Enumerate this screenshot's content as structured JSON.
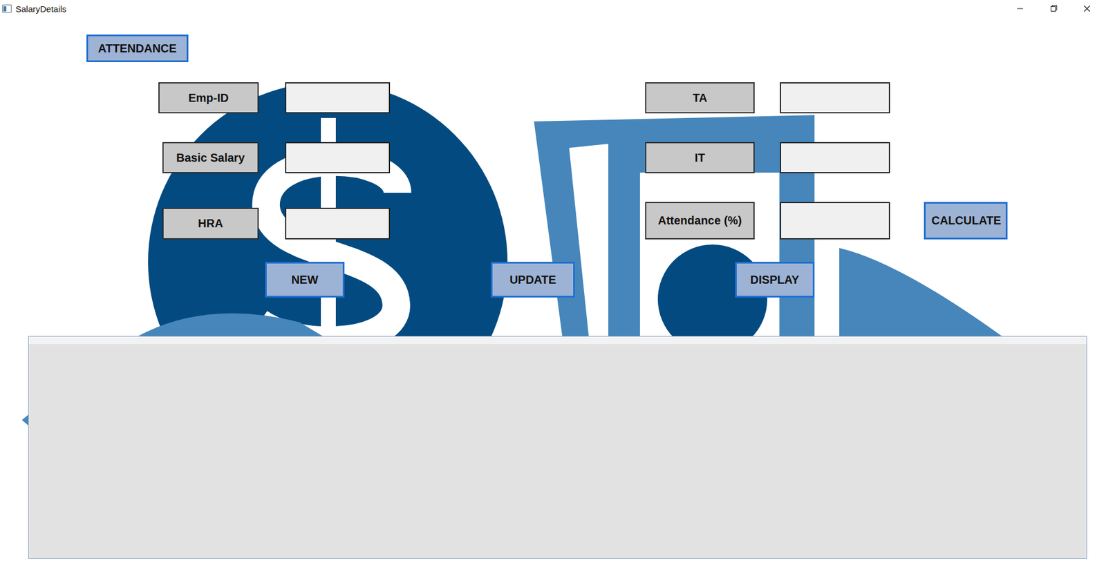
{
  "window": {
    "title": "SalaryDetails"
  },
  "top_button": {
    "label": "ATTENDANCE"
  },
  "left_fields": [
    {
      "label": "Emp-ID",
      "value": ""
    },
    {
      "label": "Basic Salary",
      "value": ""
    },
    {
      "label": "HRA",
      "value": ""
    }
  ],
  "right_fields": [
    {
      "label": "TA",
      "value": ""
    },
    {
      "label": "IT",
      "value": ""
    },
    {
      "label": "Attendance (%)",
      "value": ""
    }
  ],
  "calculate_button": {
    "label": "CALCULATE"
  },
  "action_buttons": [
    "NEW",
    "UPDATE",
    "DISPLAY"
  ],
  "data_grid": {
    "columns": [],
    "rows": []
  }
}
